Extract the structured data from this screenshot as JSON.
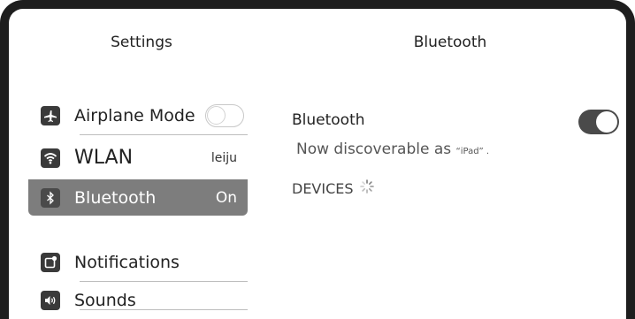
{
  "header": {
    "left_title": "Settings",
    "right_title": "Bluetooth"
  },
  "sidebar": {
    "items": [
      {
        "label": "Airplane Mode",
        "icon": "airplane-icon",
        "toggle": "off"
      },
      {
        "label": "WLAN",
        "value": "leiju",
        "icon": "wifi-icon"
      },
      {
        "label": "Bluetooth",
        "value": "On",
        "icon": "bluetooth-icon",
        "selected": true
      },
      {
        "label": "Notifications",
        "icon": "notifications-icon"
      },
      {
        "label": "Sounds",
        "icon": "speaker-icon"
      }
    ]
  },
  "detail": {
    "bluetooth_label": "Bluetooth",
    "bluetooth_toggle": "on",
    "discoverable_prefix": "Now discoverable as ",
    "discoverable_name": "“iPad” .",
    "devices_label": "DEVICES"
  },
  "colors": {
    "frame": "#1e1e1e",
    "selected_row": "#7d7d7d",
    "toggle_on": "#4a4a4a"
  }
}
